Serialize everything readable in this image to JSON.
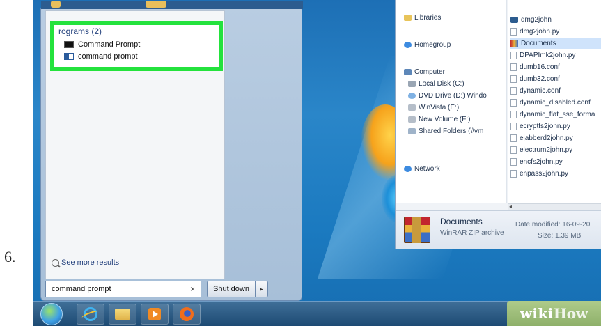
{
  "step": {
    "number": "6."
  },
  "start_menu": {
    "results_heading": "rograms (2)",
    "results": [
      {
        "label": "Command Prompt",
        "icon": "cmd-black-icon"
      },
      {
        "label": "command prompt",
        "icon": "cmd-window-icon"
      }
    ],
    "see_more": "See more results",
    "search_value": "command prompt",
    "clear_symbol": "×",
    "shutdown_label": "Shut down",
    "shutdown_arrow": "▸"
  },
  "explorer": {
    "nav": {
      "libraries": "Libraries",
      "homegroup": "Homegroup",
      "computer": "Computer",
      "local_disk": "Local Disk (C:)",
      "dvd": "DVD Drive (D:) Windo",
      "winvista": "WinVista (E:)",
      "new_volume": "New Volume (F:)",
      "shared": "Shared Folders (\\\\vm",
      "network": "Network"
    },
    "files": [
      {
        "name": "dmg2john",
        "selected": false
      },
      {
        "name": "dmg2john.py",
        "selected": false
      },
      {
        "name": "Documents",
        "selected": true
      },
      {
        "name": "DPAPImk2john.py",
        "selected": false
      },
      {
        "name": "dumb16.conf",
        "selected": false
      },
      {
        "name": "dumb32.conf",
        "selected": false
      },
      {
        "name": "dynamic.conf",
        "selected": false
      },
      {
        "name": "dynamic_disabled.conf",
        "selected": false
      },
      {
        "name": "dynamic_flat_sse_forma",
        "selected": false
      },
      {
        "name": "ecryptfs2john.py",
        "selected": false
      },
      {
        "name": "ejabberd2john.py",
        "selected": false
      },
      {
        "name": "electrum2john.py",
        "selected": false
      },
      {
        "name": "encfs2john.py",
        "selected": false
      },
      {
        "name": "enpass2john.py",
        "selected": false
      }
    ],
    "scroll_left": "◂",
    "details": {
      "name": "Documents",
      "type": "WinRAR ZIP archive",
      "modified": "Date modified: 16-09-20",
      "size": "Size: 1.39 MB"
    }
  },
  "watermark": {
    "wiki": "wiki",
    "how": "How"
  },
  "colors": {
    "highlight": "#24e23d",
    "desktop": "#1d6fb5",
    "taskbar": "#1d4a73"
  }
}
